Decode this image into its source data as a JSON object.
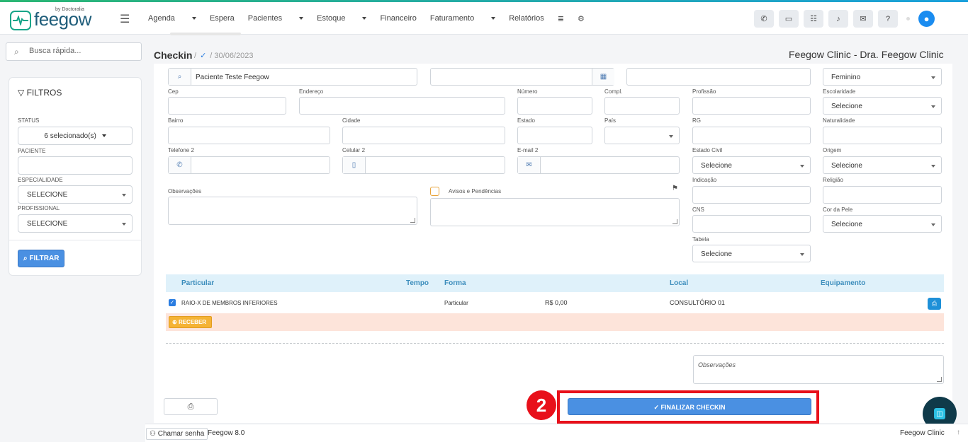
{
  "brand": {
    "name": "feegow",
    "sub": "by Doctoralia"
  },
  "nav": {
    "items": [
      {
        "label": "Agenda",
        "dropdown": true
      },
      {
        "label": "Espera",
        "dropdown": false
      },
      {
        "label": "Pacientes",
        "dropdown": true
      },
      {
        "label": "Estoque",
        "dropdown": true
      },
      {
        "label": "Financeiro",
        "dropdown": false
      },
      {
        "label": "Faturamento",
        "dropdown": true
      },
      {
        "label": "Relatórios",
        "dropdown": false
      }
    ]
  },
  "search": {
    "placeholder": "Busca rápida..."
  },
  "filters": {
    "title": "FILTROS",
    "status_label": "STATUS",
    "status_value": "6 selecionado(s)",
    "paciente_label": "PACIENTE",
    "especialidade_label": "ESPECIALIDADE",
    "especialidade_value": "SELECIONE",
    "profissional_label": "PROFISSIONAL",
    "profissional_value": "SELECIONE",
    "button": "FILTRAR"
  },
  "page": {
    "title": "Checkin",
    "date": "30/06/2023",
    "clinic": "Feegow Clinic - Dra. Feegow Clinic"
  },
  "form": {
    "patient_name": "Paciente Teste Feegow",
    "sexo": "Feminino",
    "cep": "Cep",
    "endereco": "Endereço",
    "numero": "Número",
    "compl": "Compl.",
    "profissao": "Profissão",
    "escolaridade": "Escolaridade",
    "escolaridade_value": "Selecione",
    "bairro": "Bairro",
    "cidade": "Cidade",
    "estado": "Estado",
    "pais": "País",
    "rg": "RG",
    "naturalidade": "Naturalidade",
    "telefone2": "Telefone 2",
    "celular2": "Celular 2",
    "email2": "E-mail 2",
    "estado_civil": "Estado Civil",
    "estado_civil_value": "Selecione",
    "origem": "Origem",
    "origem_value": "Selecione",
    "observacoes": "Observações",
    "avisos": "Avisos e Pendências",
    "indicacao": "Indicação",
    "religiao": "Religião",
    "cns": "CNS",
    "cor_pele": "Cor da Pele",
    "cor_pele_value": "Selecione",
    "tabela": "Tabela",
    "tabela_value": "Selecione"
  },
  "table": {
    "headers": {
      "particular": "Particular",
      "tempo": "Tempo",
      "forma": "Forma",
      "local": "Local",
      "equipamento": "Equipamento"
    },
    "row": {
      "procedure": "RAIO-X DE MEMBROS INFERIORES",
      "forma": "Particular",
      "valor": "R$ 0,00",
      "local": "CONSULTÓRIO 01"
    },
    "receber": "RECEBER"
  },
  "obs_placeholder": "Observações",
  "finalize": "FINALIZAR CHECKIN",
  "step": "2",
  "footer": {
    "chamar": "Chamar senha",
    "version": "Feegow 8.0",
    "clinic": "Feegow Clinic"
  }
}
